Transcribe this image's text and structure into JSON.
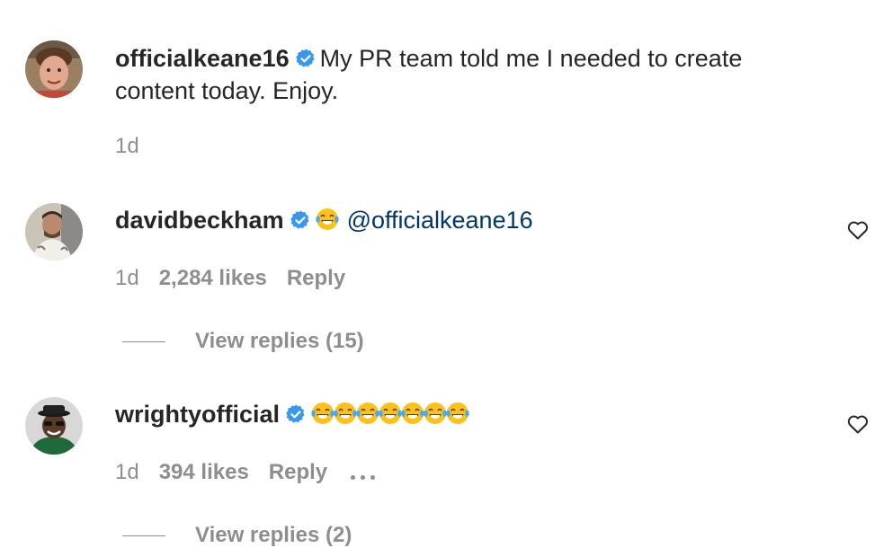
{
  "comments": [
    {
      "username": "officialkeane16",
      "verified": true,
      "text_line1": "My PR team told me I needed to create",
      "text_line2": "content today. Enjoy.",
      "time": "1d"
    },
    {
      "username": "davidbeckham",
      "verified": true,
      "emoji": "face-with-tears-of-joy",
      "mention": "@officialkeane16",
      "time": "1d",
      "likes": "2,284 likes",
      "reply_label": "Reply",
      "view_replies": "View replies (15)"
    },
    {
      "username": "wrightyofficial",
      "verified": true,
      "emoji_count": 7,
      "emoji": "face-with-tears-of-joy",
      "time": "1d",
      "likes": "394 likes",
      "reply_label": "Reply",
      "view_replies": "View replies (2)"
    }
  ],
  "icons": {
    "verified": "verified-badge-icon",
    "like": "heart-icon",
    "more": "more-options-icon"
  },
  "colors": {
    "text": "#262626",
    "secondary": "#8e8e8e",
    "mention": "#00376b",
    "verified": "#3897f0"
  }
}
